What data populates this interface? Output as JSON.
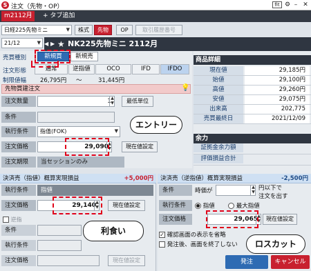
{
  "window": {
    "title": "注文（先物・OP）"
  },
  "tabs": {
    "active": "m2112月",
    "add": "+ タブ追加"
  },
  "toolbar": {
    "product_select": "日経225先物ミニ",
    "buttons": [
      "株式",
      "先物",
      "OP",
      "取引履歴番号"
    ],
    "month_select": "21/12"
  },
  "instrument": {
    "name": "NK225先物ミニ 2112月"
  },
  "order": {
    "kind_label": "売買種別",
    "kind_options": [
      "新規買",
      "新規売"
    ],
    "kind_selected": "新規買",
    "type_label": "注文形態",
    "type_options": [
      "通常",
      "逆指値",
      "OCO",
      "IFD",
      "IFDO"
    ],
    "type_selected": "IFDO",
    "limit_label": "制限値幅",
    "limit_low": "26,795円",
    "limit_sep": "〜",
    "limit_high": "31,445円"
  },
  "buy_section": {
    "header": "先物買建注文",
    "qty_label": "注文数量",
    "qty_value": "1",
    "min_unit_button": "最低単位",
    "cond_label": "条件",
    "exec_label": "執行条件",
    "exec_value": "指值(FOK)",
    "price_label": "注文価格",
    "price_value": "29,090",
    "current_price_button": "現在値設定",
    "expiry_label": "注文期限",
    "expiry_value": "当セッションのみ"
  },
  "detail": {
    "header": "商品詳細",
    "rows": [
      {
        "k": "現在値",
        "v": "29,185円"
      },
      {
        "k": "始値",
        "v": "29,100円"
      },
      {
        "k": "高値",
        "v": "29,260円"
      },
      {
        "k": "安値",
        "v": "29,075円"
      },
      {
        "k": "出来高",
        "v": "202,775"
      },
      {
        "k": "売買最終日",
        "v": "2021/12/09"
      }
    ],
    "margin_header": "余力",
    "margin_rows": [
      {
        "k": "証拠金余力額",
        "v": ""
      },
      {
        "k": "評価損益合計",
        "v": ""
      }
    ]
  },
  "profit_panel": {
    "header": "決済売（指値）概算実現損益",
    "pl": "+5,000円",
    "exec_label": "執行条件",
    "exec_value": "指値",
    "price_label": "注文価格",
    "price_value": "29,140",
    "current_price_button": "現在値設定",
    "stop_label": "逆指",
    "cond_label": "条件",
    "exec2_label": "執行条件",
    "price2_label": "注文価格",
    "current_price2_button": "現在値設定"
  },
  "stop_panel": {
    "header": "決済売（逆指値）概算実現損益",
    "pl": "-2,500円",
    "cond_label": "条件",
    "cond_text_a": "時価が",
    "cond_text_b": "円以下で",
    "cond_text_c": "注文を出す",
    "exec_label": "執行条件",
    "exec_opt1": "指値",
    "exec_opt2": "最大指値",
    "price_label": "注文価格",
    "price_value": "29,065",
    "current_price_button": "現在値設定"
  },
  "options": {
    "skip_confirm": "確認画面の表示を省略",
    "keep_open": "発注後、画面を終了しない"
  },
  "actions": {
    "submit": "発注",
    "cancel": "キャンセル"
  },
  "annotations": {
    "entry": "エントリー",
    "take_profit": "利食い",
    "stop_loss": "ロスカット"
  }
}
